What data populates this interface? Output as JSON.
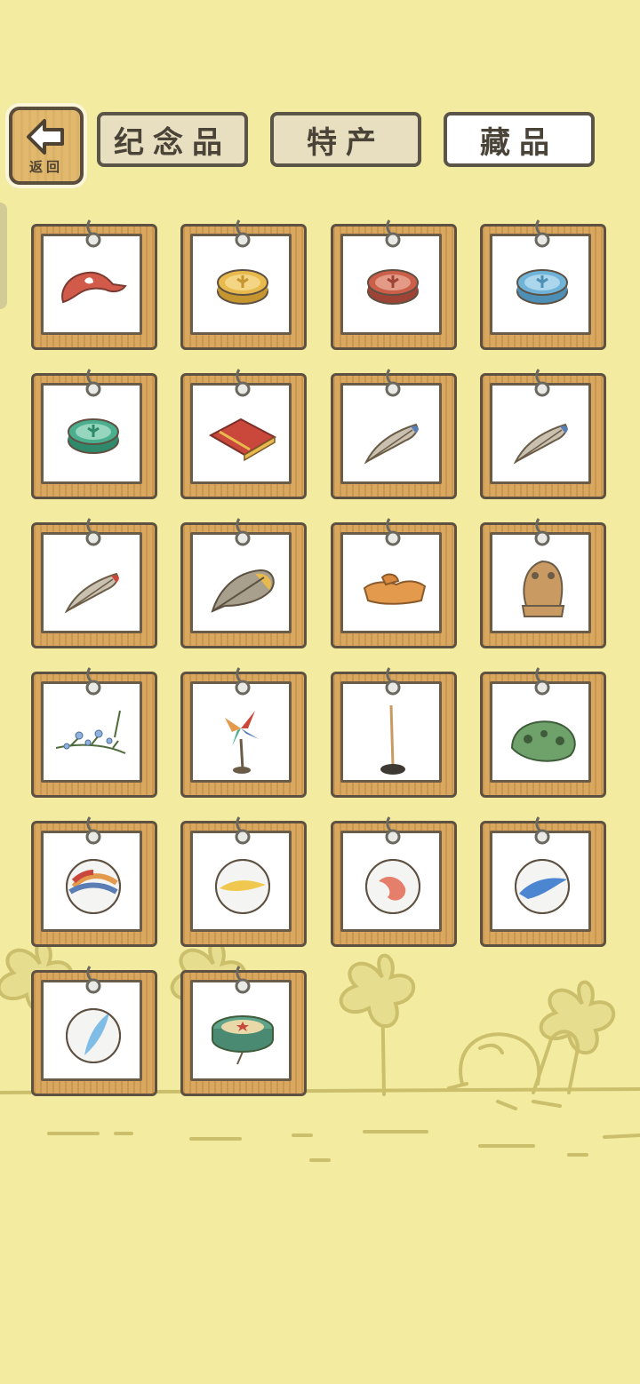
{
  "nav": {
    "back_label": "返回",
    "tabs": [
      {
        "label": "纪念品",
        "active": false
      },
      {
        "label": "特产",
        "active": false
      },
      {
        "label": "藏品",
        "active": true
      }
    ]
  },
  "collection": {
    "items": [
      {
        "icon": "red-frog-hat-icon"
      },
      {
        "icon": "yellow-clover-coin-icon"
      },
      {
        "icon": "red-clover-coin-icon"
      },
      {
        "icon": "blue-clover-coin-icon"
      },
      {
        "icon": "green-clover-coin-icon"
      },
      {
        "icon": "red-rug-icon"
      },
      {
        "icon": "striped-feather-icon"
      },
      {
        "icon": "striped-feather-icon"
      },
      {
        "icon": "red-tip-feather-icon"
      },
      {
        "icon": "golden-feather-icon"
      },
      {
        "icon": "orange-cloth-icon"
      },
      {
        "icon": "stone-frog-statue-icon"
      },
      {
        "icon": "flower-branch-icon"
      },
      {
        "icon": "pinwheel-icon"
      },
      {
        "icon": "stick-stand-icon"
      },
      {
        "icon": "green-frog-stone-icon"
      },
      {
        "icon": "rainbow-marble-icon"
      },
      {
        "icon": "yellow-marble-icon"
      },
      {
        "icon": "red-marble-icon"
      },
      {
        "icon": "blue-marble-icon"
      },
      {
        "icon": "light-blue-marble-icon"
      },
      {
        "icon": "star-drum-icon"
      }
    ]
  },
  "colors": {
    "background": "#f2eba0",
    "frame_wood": "#d9a85e",
    "frame_border": "#5e5142",
    "tab_inactive": "#e8dec0",
    "tab_active": "#ffffff",
    "scenery_line": "#c9bd6a"
  }
}
